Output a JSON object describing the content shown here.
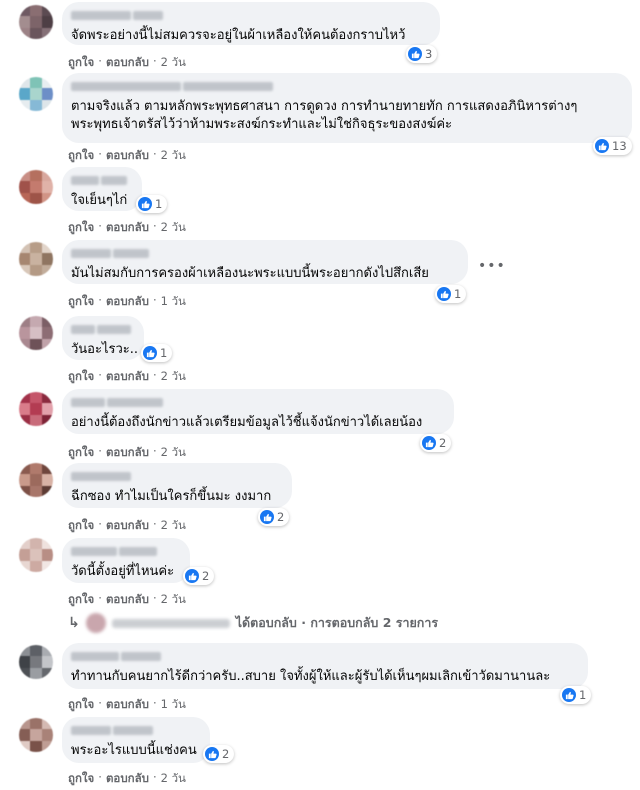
{
  "colors": {
    "like_blue": "#1877f2",
    "bubble_bg": "#f0f2f5",
    "meta_text": "#65676b"
  },
  "comments": [
    {
      "text": "จัดพระอย่างนี้ไม่สมควรจะอยู่ในผ้าเหลืองให้คนต้องกราบไหว้",
      "reactions": "3",
      "like": "ถูกใจ",
      "reply": "ตอบกลับ",
      "time": "2 วัน",
      "avatar_colors": [
        "#6f5a63",
        "#8a6e72",
        "#5c4b52",
        "#a38d8f",
        "#7d6469",
        "#4e3f45",
        "#9c8286",
        "#6a555c",
        "#857077"
      ]
    },
    {
      "text_lines": [
        "ตามจริงแล้ว ตามหลักพระพุทธศาสนา การดูดวง การทำนายทายทัก การแสดงอภินิหารต่างๆ",
        "พระพุทธเจ้าตรัสไว้ว่าห้ามพระสงฆ์กระทำและไม่ใช่กิจธุระของสงฆ์ค่ะ"
      ],
      "reactions": "13",
      "like": "ถูกใจ",
      "reply": "ตอบกลับ",
      "time": "2 วัน",
      "avatar_colors": [
        "#dfe6ea",
        "#7fc3b6",
        "#e8eef1",
        "#5aa7c9",
        "#a9d5cd",
        "#6d8fc7",
        "#e6ecef",
        "#86b9d6",
        "#dde5e9"
      ]
    },
    {
      "text": "ใจเย็นๆไก่",
      "reactions": "1",
      "like": "ถูกใจ",
      "reply": "ตอบกลับ",
      "time": "2 วัน",
      "avatar_colors": [
        "#c98e85",
        "#b5705f",
        "#d8a79d",
        "#a0524a",
        "#c47b6e",
        "#e0b2a8",
        "#b86657",
        "#9e5448",
        "#d19486"
      ]
    },
    {
      "text": "มันไม่สมกับการครองผ้าเหลืองนะพระแบบนี้พระอยากดังไปสึกเสีย",
      "reactions": "1",
      "like": "ถูกใจ",
      "reply": "ตอบกลับ",
      "time": "1 วัน",
      "avatar_colors": [
        "#d3c2b4",
        "#b79d88",
        "#e1d4c9",
        "#a68670",
        "#c9b2a0",
        "#8f7561",
        "#d8c7b9",
        "#b49a85",
        "#c2ad9b"
      ]
    },
    {
      "text": "วันอะไรวะ..",
      "reactions": "1",
      "like": "ถูกใจ",
      "reply": "ตอบกลับ",
      "time": "2 วัน",
      "avatar_colors": [
        "#9e7f86",
        "#c5a9b0",
        "#7c5f66",
        "#b9959d",
        "#d6bfc4",
        "#8d6d74",
        "#a98890",
        "#6e5258",
        "#c0a2a9"
      ]
    },
    {
      "text": "อย่างนี้ต้องถึงนักข่าวแล้วเตรียมข้อมูลไว้ชี้แจ้งนักข่าวได้เลยน้อง",
      "reactions": "2",
      "like": "ถูกใจ",
      "reply": "ตอบกลับ",
      "time": "2 วัน",
      "avatar_colors": [
        "#a3324a",
        "#c5566a",
        "#8a2a3e",
        "#d97c8a",
        "#b33c52",
        "#e2a1ab",
        "#9b2f45",
        "#c86b7a",
        "#7e2437"
      ]
    },
    {
      "text": "ฉีกซอง ทำไมเป็นใครก็ขึ้นมะ งงมาก",
      "reactions": "2",
      "like": "ถูกใจ",
      "reply": "ตอบกลับ",
      "time": "2 วัน",
      "avatar_colors": [
        "#8a5a4f",
        "#b07a6c",
        "#6f463d",
        "#c99a8b",
        "#9c6a5d",
        "#d8b2a5",
        "#7d5046",
        "#a8766a",
        "#5e3c35"
      ]
    },
    {
      "text": "วัดนี้ตั้งอยู่ที่ไหนค่ะ",
      "reactions": "2",
      "like": "ถูกใจ",
      "reply": "ตอบกลับ",
      "time": "2 วัน",
      "avatar_colors": [
        "#e3cfca",
        "#d2b4ad",
        "#efe2de",
        "#c49f96",
        "#dbc2bb",
        "#b88e85",
        "#e8d7d2",
        "#cdaaa2",
        "#f1e6e3"
      ]
    },
    {
      "text": "ทำทานกับคนยากไร้ดีกว่าครับ..สบาย ใจทั้งผู้ให้และผู้รับได้เห็นๆผมเลิกเข้าวัดมานานละ",
      "reactions": "1",
      "like": "ถูกใจ",
      "reply": "ตอบกลับ",
      "time": "1 วัน",
      "avatar_colors": [
        "#8c8f94",
        "#5d6066",
        "#a9acb1",
        "#3f4247",
        "#77797e",
        "#c3c5c9",
        "#4d5055",
        "#9a9da2",
        "#65686d"
      ]
    },
    {
      "text": "พระอะไรแบบนี้แช่งคน",
      "reactions": "2",
      "like": "ถูกใจ",
      "reply": "ตอบกลับ",
      "time": "2 วัน",
      "avatar_colors": [
        "#b8958d",
        "#9a7268",
        "#d4b9b2",
        "#855e55",
        "#c6a59d",
        "#a98278",
        "#e0cbc5",
        "#7a5249",
        "#bf9d94"
      ]
    }
  ],
  "reply_row": {
    "arrow": "↳",
    "text": "ได้ตอบกลับ · การตอบกลับ 2 รายการ"
  },
  "more_menu": "•••",
  "separator": "·"
}
